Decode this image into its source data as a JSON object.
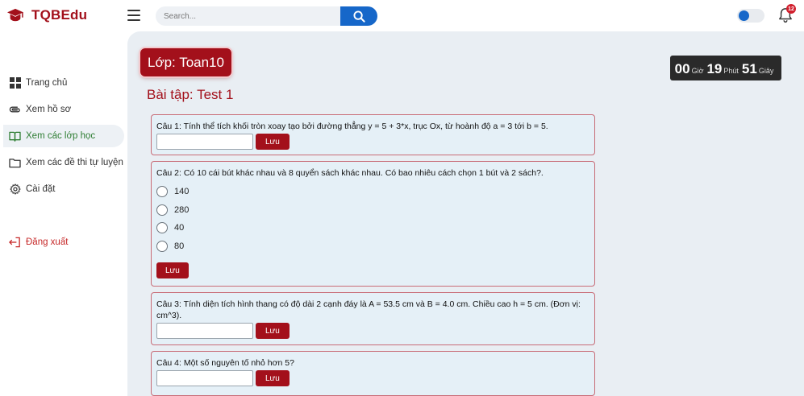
{
  "app": {
    "name": "TQBEdu"
  },
  "header": {
    "search_placeholder": "Search...",
    "notifications_count": "12"
  },
  "sidebar": {
    "items": [
      {
        "label": "Trang chủ",
        "icon": "dashboard-icon"
      },
      {
        "label": "Xem hồ sơ",
        "icon": "paperclip-icon"
      },
      {
        "label": "Xem các lớp học",
        "icon": "book-icon",
        "active": true
      },
      {
        "label": "Xem các đề thi tự luyện",
        "icon": "folder-icon"
      },
      {
        "label": "Cài đặt",
        "icon": "gear-icon"
      }
    ],
    "logout_label": "Đăng xuất"
  },
  "main": {
    "class_label": "Lớp: Toan10",
    "exercise_title": "Bài tập: Test 1",
    "timer": {
      "hours": "00",
      "hours_unit": "Giờ",
      "minutes": "19",
      "minutes_unit": "Phút",
      "seconds": "51",
      "seconds_unit": "Giây"
    },
    "save_label": "Lưu",
    "questions": [
      {
        "text": "Câu 1: Tính thể tích khối tròn xoay tạo bởi đường thẳng y = 5 + 3*x, trục Ox, từ hoành độ a = 3 tới b = 5."
      },
      {
        "text": "Câu 2: Có 10 cái bút khác nhau và 8 quyển sách khác nhau. Có bao nhiêu cách chọn 1 bút và 2 sách?.",
        "options": [
          "140",
          "280",
          "40",
          "80"
        ]
      },
      {
        "text": "Câu 3: Tính diện tích hình thang có độ dài 2 cạnh đáy là A = 53.5 cm và B = 4.0 cm. Chiều cao h = 5 cm. (Đơn vị: cm^3)."
      },
      {
        "text": "Câu 4: Một số nguyên tố nhỏ hơn 5?"
      }
    ]
  },
  "colors": {
    "brand": "#a3101b",
    "accent": "#1667c9",
    "active_nav": "#2e7d32",
    "main_bg": "#e9eef3",
    "card_bg": "#e5f0f7"
  }
}
